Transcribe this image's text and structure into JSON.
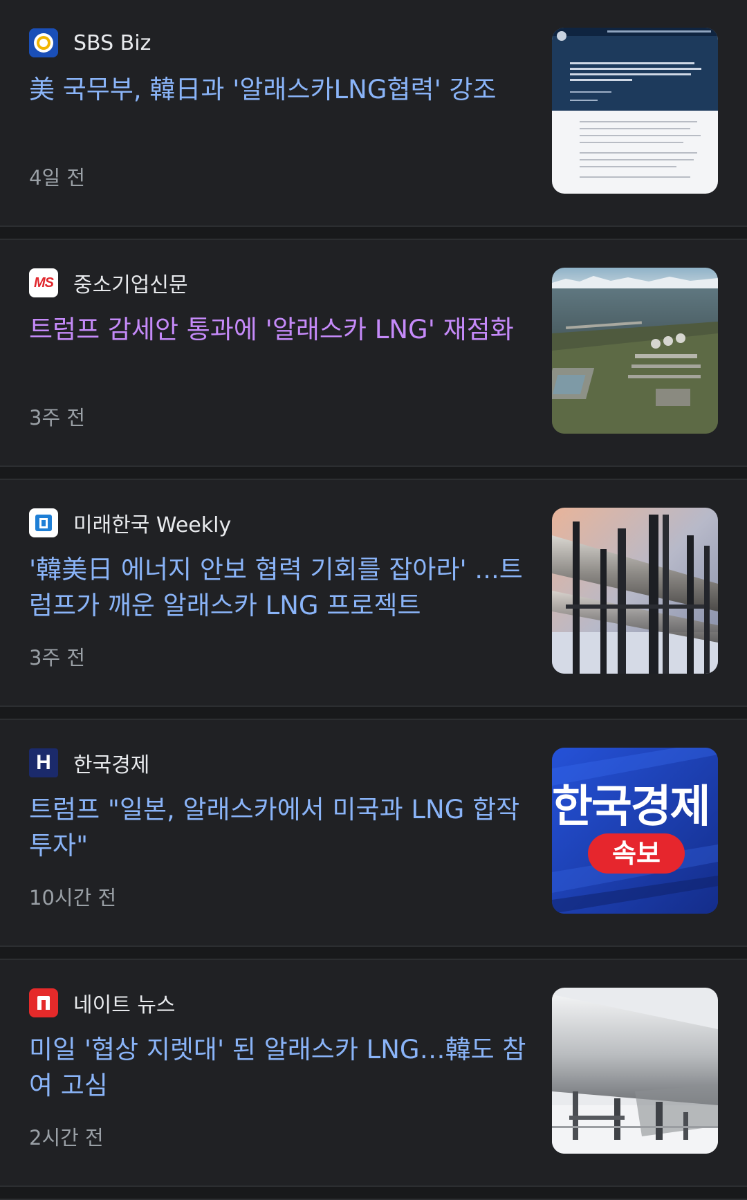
{
  "articles": [
    {
      "source": "SBS Biz",
      "headline": "美 국무부, 韓日과 '알래스카LNG협력' 강조",
      "time": "4일 전",
      "visited": false
    },
    {
      "source": "중소기업신문",
      "logo_text": "MS",
      "headline": "트럼프 감세안 통과에 '알래스카 LNG' 재점화",
      "time": "3주 전",
      "visited": true
    },
    {
      "source": "미래한국 Weekly",
      "headline": "'韓美日 에너지 안보 협력 기회를 잡아라' ...트럼프가 깨운 알래스카 LNG 프로젝트",
      "time": "3주 전",
      "visited": false
    },
    {
      "source": "한국경제",
      "logo_text": "H",
      "headline": "트럼프 \"일본, 알래스카에서 미국과 LNG 합작 투자\"",
      "time": "10시간 전",
      "visited": false,
      "thumb_text": "한국경제",
      "thumb_badge": "속보"
    },
    {
      "source": "네이트 뉴스",
      "headline": "미일 '협상 지렛대' 된 알래스카 LNG…韓도 참여 고심",
      "time": "2시간 전",
      "visited": false
    }
  ],
  "colors": {
    "background": "#202124",
    "headline": "#8ab4f8",
    "headline_visited": "#c58af9",
    "meta": "#9aa0a6"
  }
}
